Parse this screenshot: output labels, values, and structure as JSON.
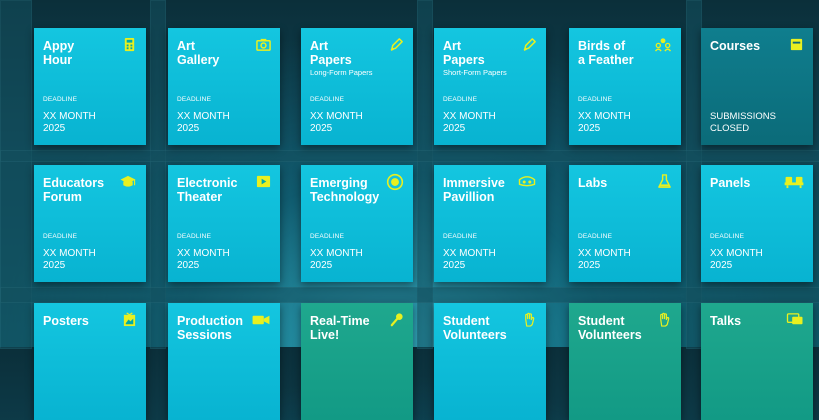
{
  "accent_color": "#e8f020",
  "tiles": [
    {
      "title": "Appy\nHour",
      "subtitle": "",
      "deadline_label": "DEADLINE",
      "date": "XX MONTH\n2025",
      "icon": "calculator-icon"
    },
    {
      "title": "Art\nGallery",
      "subtitle": "",
      "deadline_label": "DEADLINE",
      "date": "XX MONTH\n2025",
      "icon": "camera-icon"
    },
    {
      "title": "Art\nPapers",
      "subtitle": "Long-Form Papers",
      "deadline_label": "DEADLINE",
      "date": "XX MONTH\n2025",
      "icon": "pen-icon"
    },
    {
      "title": "Art\nPapers",
      "subtitle": "Short-Form Papers",
      "deadline_label": "DEADLINE",
      "date": "XX MONTH\n2025",
      "icon": "pen-icon"
    },
    {
      "title": "Birds of\na Feather",
      "subtitle": "",
      "deadline_label": "DEADLINE",
      "date": "XX MONTH\n2025",
      "icon": "people-group-icon"
    },
    {
      "title": "Courses",
      "subtitle": "",
      "deadline_label": "",
      "date": "SUBMISSIONS\nCLOSED",
      "icon": "book-icon"
    },
    {
      "title": "Educators\nForum",
      "subtitle": "",
      "deadline_label": "DEADLINE",
      "date": "XX MONTH\n2025",
      "icon": "graduation-cap-icon"
    },
    {
      "title": "Electronic\nTheater",
      "subtitle": "",
      "deadline_label": "DEADLINE",
      "date": "XX MONTH\n2025",
      "icon": "play-icon"
    },
    {
      "title": "Emerging\nTechnology",
      "subtitle": "",
      "deadline_label": "DEADLINE",
      "date": "XX MONTH\n2025",
      "icon": "target-icon"
    },
    {
      "title": "Immersive\nPavillion",
      "subtitle": "",
      "deadline_label": "DEADLINE",
      "date": "XX MONTH\n2025",
      "icon": "vr-headset-icon"
    },
    {
      "title": "Labs",
      "subtitle": "",
      "deadline_label": "DEADLINE",
      "date": "XX MONTH\n2025",
      "icon": "flask-icon"
    },
    {
      "title": "Panels",
      "subtitle": "",
      "deadline_label": "DEADLINE",
      "date": "XX MONTH\n2025",
      "icon": "seats-icon"
    },
    {
      "title": "Posters",
      "subtitle": "",
      "deadline_label": "",
      "date": "",
      "icon": "poster-icon"
    },
    {
      "title": "Production\nSessions",
      "subtitle": "",
      "deadline_label": "",
      "date": "",
      "icon": "video-camera-icon"
    },
    {
      "title": "Real-Time\nLive!",
      "subtitle": "",
      "deadline_label": "",
      "date": "",
      "icon": "microphone-icon"
    },
    {
      "title": "Student\nVolunteers",
      "subtitle": "",
      "deadline_label": "",
      "date": "",
      "icon": "hand-icon"
    },
    {
      "title": "Student\nVolunteers",
      "subtitle": "",
      "deadline_label": "",
      "date": "",
      "icon": "hand-icon"
    },
    {
      "title": "Talks",
      "subtitle": "",
      "deadline_label": "",
      "date": "",
      "icon": "chat-icon"
    }
  ]
}
